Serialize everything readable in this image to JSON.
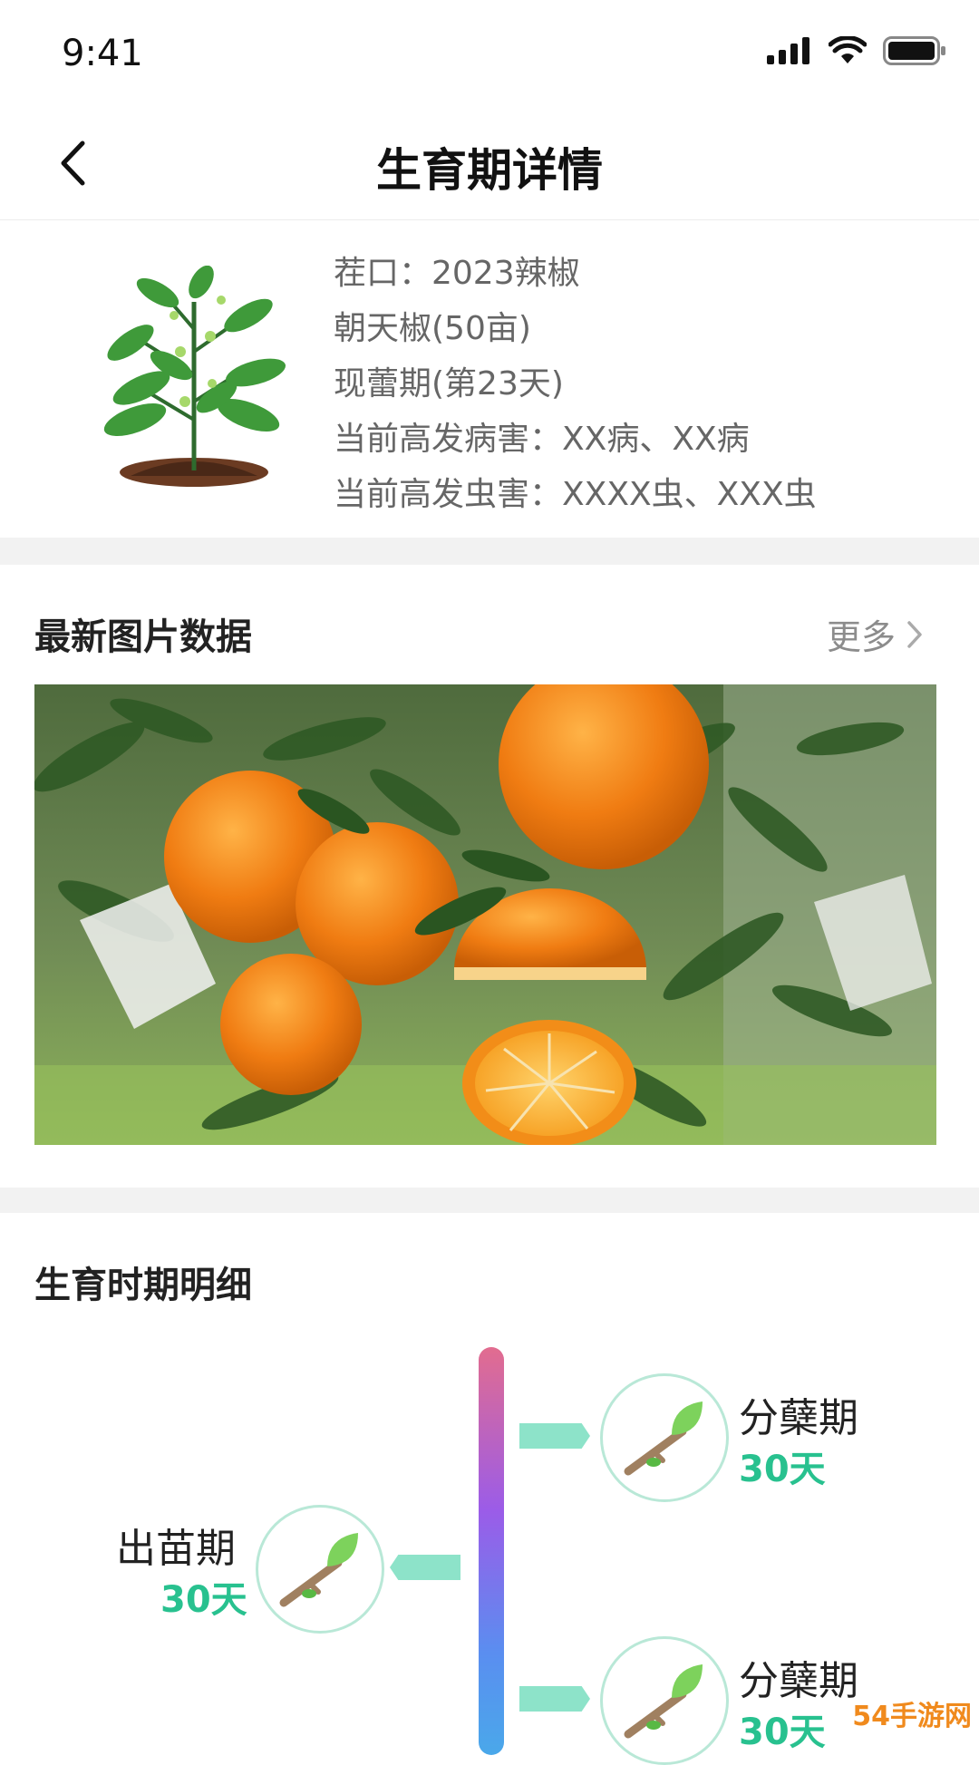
{
  "status_bar": {
    "time": "9:41"
  },
  "nav": {
    "title": "生育期详情"
  },
  "crop": {
    "lines": [
      "茬口：2023辣椒",
      "朝天椒(50亩)",
      "现蕾期(第23天)",
      "当前高发病害：XX病、XX病",
      "当前高发虫害：XXXX虫、XXX虫"
    ]
  },
  "photos": {
    "title": "最新图片数据",
    "more": "更多"
  },
  "stages": {
    "title": "生育时期明细",
    "items": [
      {
        "name": "分蘖期",
        "days": "30天",
        "side": "right"
      },
      {
        "name": "出苗期",
        "days": "30天",
        "side": "left"
      },
      {
        "name": "分蘖期",
        "days": "30天",
        "side": "right"
      }
    ]
  },
  "watermark": {
    "text": "54手游网"
  },
  "colors": {
    "accent": "#28c18f",
    "connector": "#8de3c9",
    "circle_border": "#b9e8d7",
    "section_gap": "#f2f2f2"
  },
  "icons": [
    "back-arrow-icon",
    "signal-icon",
    "wifi-icon",
    "battery-icon",
    "chevron-right-icon",
    "sprout-icon"
  ]
}
